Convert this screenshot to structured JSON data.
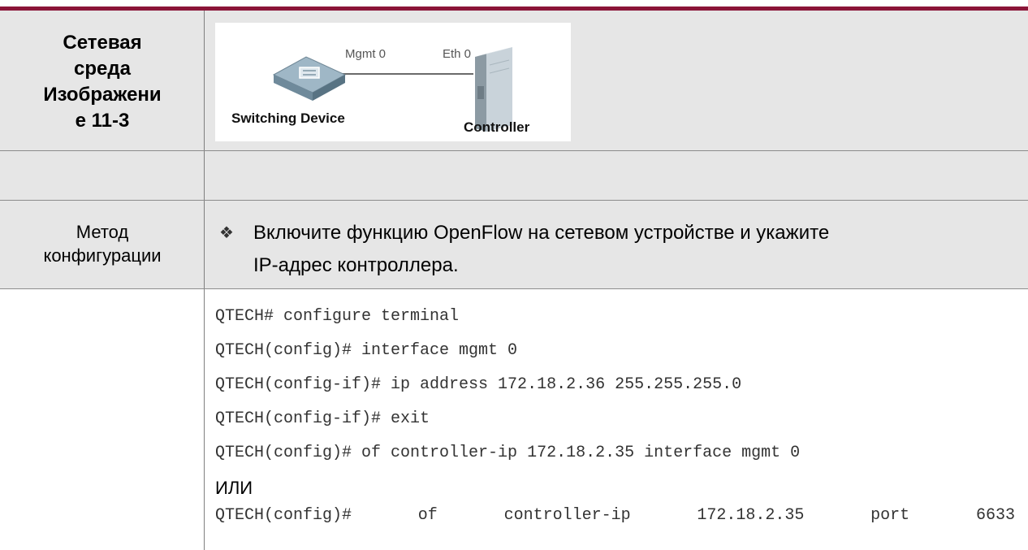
{
  "table": {
    "env_label_lines": [
      "Сетевая",
      "среда",
      "Изображени",
      "е 11-3"
    ],
    "diagram": {
      "port_left": "Mgmt 0",
      "port_right": "Eth 0",
      "device_left": "Switching Device",
      "device_right": "Controller"
    },
    "method_label_lines": [
      "Метод",
      "конфигурации"
    ],
    "method_bullet": "❖",
    "method_text_line1": "Включите функцию OpenFlow на сетевом устройстве и укажите",
    "method_text_line2": "IP-адрес контроллера.",
    "code_lines": [
      "QTECH# configure terminal",
      "QTECH(config)# interface mgmt 0",
      "QTECH(config-if)# ip address 172.18.2.36 255.255.255.0",
      "QTECH(config-if)# exit",
      "QTECH(config)# of controller-ip 172.18.2.35 interface mgmt 0"
    ],
    "or_text": "ИЛИ",
    "last_code_tokens": [
      "QTECH(config)#",
      "of",
      "controller-ip",
      "172.18.2.35",
      "port",
      "6633"
    ]
  },
  "colors": {
    "top_rule": "#8b1538",
    "row_shade": "#e6e6e6"
  }
}
